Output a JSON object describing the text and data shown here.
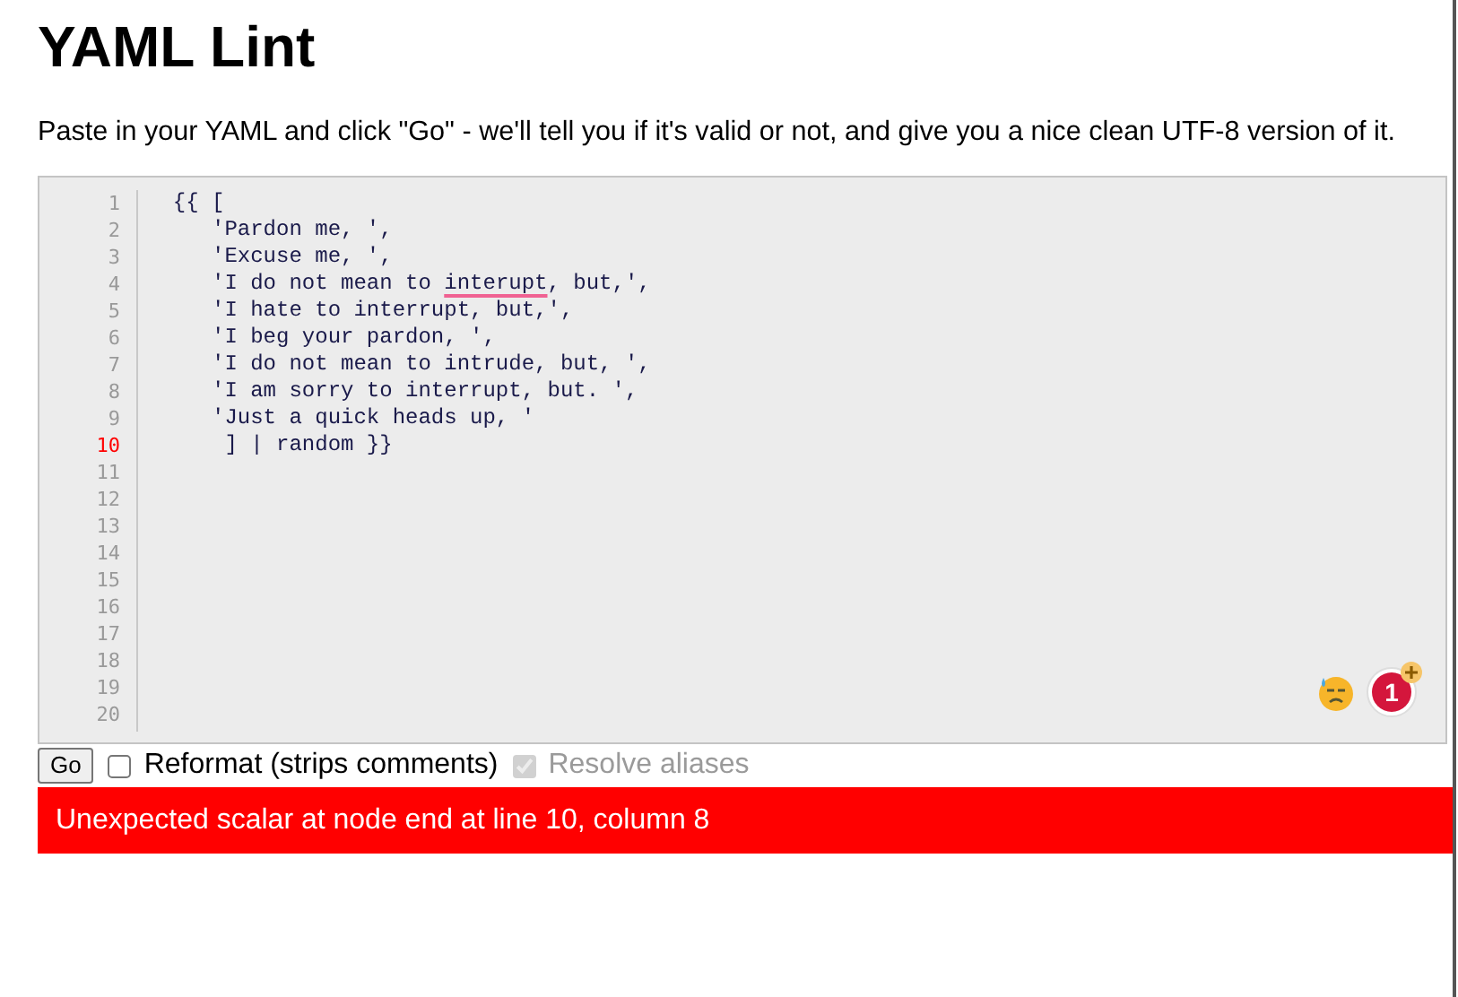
{
  "title": "YAML Lint",
  "intro": "Paste in your YAML and click \"Go\" - we'll tell you if it's valid or not, and give you a nice clean UTF-8 version of it.",
  "editor": {
    "lines": [
      {
        "number": "1",
        "text": "  {{ [",
        "error": false
      },
      {
        "number": "2",
        "text": "     'Pardon me, ',",
        "error": false
      },
      {
        "number": "3",
        "text": "     'Excuse me, ',",
        "error": false
      },
      {
        "number": "4",
        "segments": [
          {
            "text": "     'I do not mean to "
          },
          {
            "text": "interupt",
            "misspelled": true
          },
          {
            "text": ", but,',"
          }
        ],
        "error": false
      },
      {
        "number": "5",
        "text": "     'I hate to interrupt, but,',",
        "error": false
      },
      {
        "number": "6",
        "text": "     'I beg your pardon, ',",
        "error": false
      },
      {
        "number": "7",
        "text": "     'I do not mean to intrude, but, ',",
        "error": false
      },
      {
        "number": "8",
        "text": "     'I am sorry to interrupt, but. ',",
        "error": false
      },
      {
        "number": "9",
        "text": "     'Just a quick heads up, '",
        "error": false
      },
      {
        "number": "10",
        "text": "      ] | random }}",
        "error": true
      },
      {
        "number": "11",
        "error": false
      },
      {
        "number": "12",
        "error": false
      },
      {
        "number": "13",
        "error": false
      },
      {
        "number": "14",
        "error": false
      },
      {
        "number": "15",
        "error": false
      },
      {
        "number": "16",
        "error": false
      },
      {
        "number": "17",
        "error": false
      },
      {
        "number": "18",
        "error": false
      },
      {
        "number": "19",
        "error": false
      },
      {
        "number": "20",
        "error": false
      }
    ],
    "badge_count": "1"
  },
  "go_button": "Go",
  "options": [
    {
      "label": "Reformat (strips comments)",
      "checked": false,
      "disabled": false
    },
    {
      "label": "Resolve aliases",
      "checked": true,
      "disabled": true
    }
  ],
  "error_message": "Unexpected scalar at node end at line 10, column 8"
}
